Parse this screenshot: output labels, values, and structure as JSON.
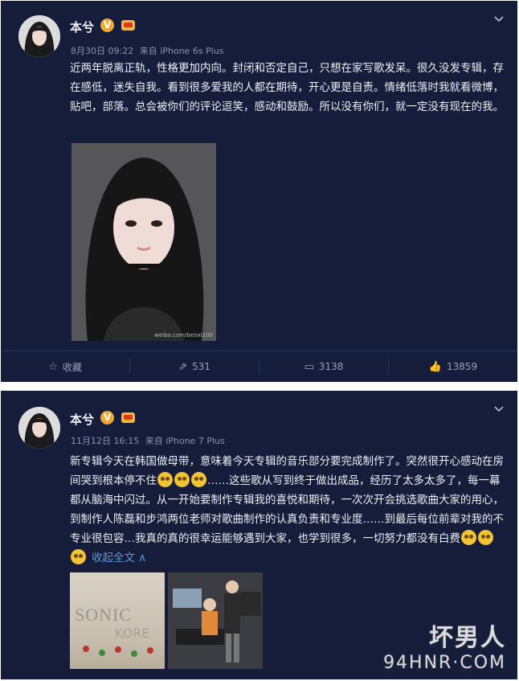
{
  "posts": [
    {
      "username": "本兮",
      "v_badge": "V",
      "timestamp": "8月30日 09:22",
      "source": "来自 iPhone 6s Plus",
      "text": "近两年脱离正轨，性格更加内向。封闭和否定自己，只想在家写歌发呆。很久没发专辑，存在感低，迷失自我。看到很多爱我的人都在期待，开心更是自责。情绪低落时我就看微博，贴吧，部落。总会被你们的评论逗笑，感动和鼓励。所以没有你们，就一定没有现在的我。",
      "image_caption": "weibo.com/benxi100",
      "actions": {
        "favorite_label": "收藏",
        "repost_count": "531",
        "comment_count": "3138",
        "like_count": "13859"
      }
    },
    {
      "username": "本兮",
      "v_badge": "V",
      "timestamp": "11月12日 16:15",
      "source": "来自 iPhone 7 Plus",
      "text_part1": "新专辑今天在韩国做母带，意味着今天专辑的音乐部分要完成制作了。突然很开心感动在房间哭到根本停不住",
      "text_part2": "……这些歌从写到终于做出成品，经历了太多太多了，每一幕都从脑海中闪过。从一开始要制作专辑我的喜悦和期待，一次次开会挑选歌曲大家的用心，到制作人陈磊和步鸿两位老师对歌曲制作的认真负责和专业度……到最后每位前辈对我的不专业很包容…我真的真的很幸运能够遇到大家，也学到很多，一切努力都没有白费",
      "collapse_label": "收起全文 ∧",
      "image1_text_a": "SONIC",
      "image1_text_b": "KORE"
    }
  ],
  "watermark": {
    "main": "坏男人",
    "sub": "94HNR·COM"
  },
  "icons": {
    "chevron": "chevron-down-icon",
    "favorite": "star-icon",
    "repost": "repost-icon",
    "comment": "comment-icon",
    "like": "thumbs-up-icon",
    "emoji": "crying-face-icon"
  },
  "colors": {
    "card_background": "#151d3a",
    "vip_badge": "#f0a92b",
    "link": "#5b9ad8"
  }
}
